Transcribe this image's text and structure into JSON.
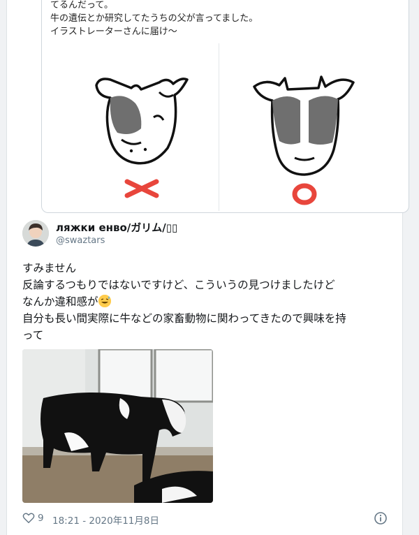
{
  "quote": {
    "line1": "てるんだって。",
    "line2": "牛の遺伝とか研究してたうちの父が言ってました。",
    "line3": "イラストレーターさんに届け〜"
  },
  "tweet": {
    "author_name": "ляжки енво/ガリム/▯▯",
    "handle": "@swaztars",
    "lines": [
      "すみません",
      "反論するつもりではないですけど、こういうの見つけましたけど",
      "なんか違和感が",
      "自分も長い間実際に牛などの家畜動物に関わってきたので興味を持",
      "って"
    ],
    "emoji": "sweat-smile"
  },
  "footer": {
    "likes": "9",
    "timestamp": "18:21 - 2020年11月8日"
  },
  "colors": {
    "wrong_mark": "#e8463c",
    "correct_mark": "#e8463c",
    "cow_patch": "#6f6f6f"
  },
  "icons": [
    "heart-icon",
    "info-icon",
    "wrong-mark-icon",
    "correct-mark-icon"
  ]
}
